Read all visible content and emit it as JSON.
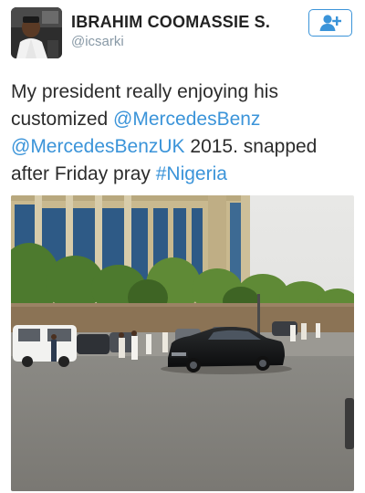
{
  "user": {
    "display_name": "IBRAHIM COOMASSIE S.",
    "handle": "@icsarki",
    "avatar": "profile-photo"
  },
  "follow_button": {
    "icon": "add-user-icon",
    "accent": "#3b94d9"
  },
  "tweet": {
    "text_1": "My president really enjoying his customized ",
    "mention_1": "@MercedesBenz",
    "text_2": " ",
    "mention_2": "@MercedesBenzUK",
    "text_3": " 2015. snapped after Friday pray ",
    "hashtag": "#Nigeria",
    "link_color": "#3b94d9"
  },
  "media": {
    "type": "photo",
    "subject": "black-sedan-on-road"
  }
}
